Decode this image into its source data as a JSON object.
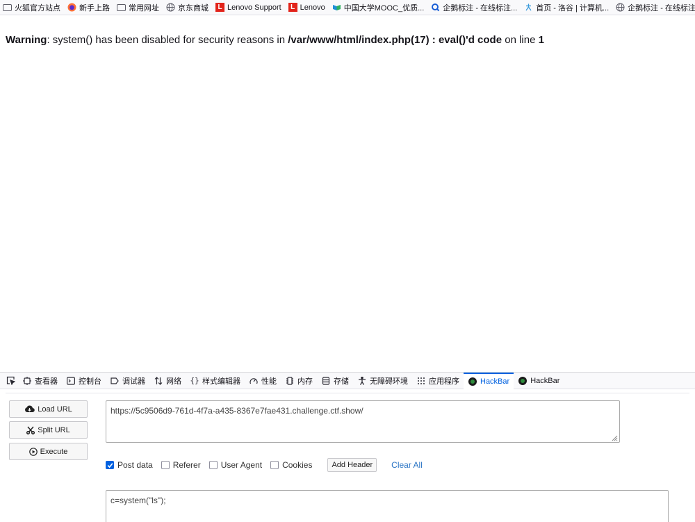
{
  "bookmarks": [
    {
      "label": "火狐官方站点",
      "icon": "folder-icon"
    },
    {
      "label": "新手上路",
      "icon": "firefox-icon"
    },
    {
      "label": "常用网址",
      "icon": "folder-icon"
    },
    {
      "label": "京东商城",
      "icon": "globe-icon"
    },
    {
      "label": "Lenovo Support",
      "icon": "lenovo-icon"
    },
    {
      "label": "Lenovo",
      "icon": "lenovo-icon"
    },
    {
      "label": "中国大学MOOC_优质...",
      "icon": "mooc-icon"
    },
    {
      "label": "企鹅标注 - 在线标注...",
      "icon": "q-icon"
    },
    {
      "label": "首页 - 洛谷 | 计算机...",
      "icon": "luogu-icon"
    },
    {
      "label": "企鹅标注 - 在线标注",
      "icon": "globe-icon"
    }
  ],
  "warning": {
    "label": "Warning",
    "text1": ": system() has been disabled for security reasons in ",
    "path": "/var/www/html/index.php(17) : eval()'d code",
    "text2": " on line ",
    "line": "1"
  },
  "devtools": {
    "tabs": [
      {
        "label": "查看器",
        "icon": "inspector-icon"
      },
      {
        "label": "控制台",
        "icon": "console-icon"
      },
      {
        "label": "调试器",
        "icon": "debugger-icon"
      },
      {
        "label": "网络",
        "icon": "network-icon"
      },
      {
        "label": "样式编辑器",
        "icon": "style-editor-icon"
      },
      {
        "label": "性能",
        "icon": "performance-icon"
      },
      {
        "label": "内存",
        "icon": "memory-icon"
      },
      {
        "label": "存储",
        "icon": "storage-icon"
      },
      {
        "label": "无障碍环境",
        "icon": "accessibility-icon"
      },
      {
        "label": "应用程序",
        "icon": "application-icon"
      },
      {
        "label": "HackBar",
        "icon": "hackbar-icon"
      },
      {
        "label": "HackBar",
        "icon": "hackbar-icon"
      }
    ],
    "active_tab": "HackBar"
  },
  "hackbar": {
    "load_url": "Load URL",
    "split_url": "Split URL",
    "execute": "Execute",
    "url": "https://5c9506d9-761d-4f7a-a435-8367e7fae431.challenge.ctf.show/",
    "options": {
      "post_data": {
        "label": "Post data",
        "checked": true
      },
      "referer": {
        "label": "Referer",
        "checked": false
      },
      "user_agent": {
        "label": "User Agent",
        "checked": false
      },
      "cookies": {
        "label": "Cookies",
        "checked": false
      }
    },
    "add_header": "Add Header",
    "clear_all": "Clear All",
    "post_body": "c=system(\"ls\");"
  },
  "colors": {
    "accent": "#0061e0",
    "link": "#2a74c4",
    "lenovo": "#e2231a"
  }
}
